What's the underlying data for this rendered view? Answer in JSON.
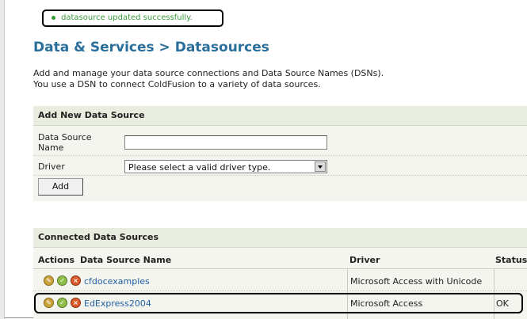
{
  "message": {
    "text": "datasource updated successfully."
  },
  "page": {
    "title": "Data & Services > Datasources",
    "description_line1": "Add and manage your data source connections and Data Source Names (DSNs).",
    "description_line2": "You use a DSN to connect ColdFusion to a variety of data sources."
  },
  "add_panel": {
    "heading": "Add New Data Source",
    "name_label": "Data Source Name",
    "name_value": "",
    "driver_label": "Driver",
    "driver_selected": "Please select a valid driver type.",
    "add_button": "Add"
  },
  "connected": {
    "heading": "Connected Data Sources",
    "columns": [
      "Actions",
      "Data Source Name",
      "Driver",
      "Status"
    ],
    "rows": [
      {
        "name": "cfdocexamples",
        "driver": "Microsoft Access with Unicode",
        "status": ""
      },
      {
        "name": "EdExpress2004",
        "driver": "Microsoft Access",
        "status": "OK"
      }
    ]
  },
  "icons": [
    "edit-icon",
    "verify-icon",
    "delete-icon"
  ],
  "colors": {
    "title": "#2a6f9b",
    "link": "#1f5fa6",
    "success": "#3b9c3b",
    "panel_header": "#e8eddf"
  }
}
